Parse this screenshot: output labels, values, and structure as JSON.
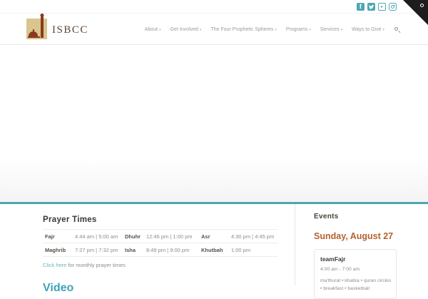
{
  "topbar": {
    "social_links": [
      {
        "name": "facebook",
        "glyph": "f"
      },
      {
        "name": "twitter"
      },
      {
        "name": "youtube",
        "glyph": "▸"
      },
      {
        "name": "instagram"
      }
    ]
  },
  "header": {
    "logo_text": "ISBCC",
    "nav": [
      {
        "label": "About"
      },
      {
        "label": "Get Involved"
      },
      {
        "label": "The Four Prophetic Spheres"
      },
      {
        "label": "Programs"
      },
      {
        "label": "Services"
      },
      {
        "label": "Ways to Give"
      }
    ]
  },
  "prayer_times": {
    "title": "Prayer Times",
    "rows": [
      [
        {
          "label": "Fajr",
          "time": "4:44 am | 5:00 am"
        },
        {
          "label": "Dhuhr",
          "time": "12:46 pm | 1:00 pm"
        },
        {
          "label": "Asr",
          "time": "4:30 pm | 4:45 pm"
        }
      ],
      [
        {
          "label": "Maghrib",
          "time": "7:27 pm | 7:32 pm"
        },
        {
          "label": "Isha",
          "time": "8:49 pm | 9:00 pm"
        },
        {
          "label": "Khutbah",
          "time": "1:00 pm"
        }
      ]
    ],
    "monthly_link": "Click here",
    "monthly_suffix": " for monthly prayer times"
  },
  "video_section": {
    "title": "Video"
  },
  "events": {
    "title": "Events",
    "date_heading": "Sunday, August 27",
    "event": {
      "name": "teamFajr",
      "time": "4:00 am - 7:00 am",
      "description": "ma'thurat • khatira • quran circles • breakfast • basketball"
    }
  },
  "icons": {
    "chevron_down": "▾"
  },
  "colors": {
    "teal": "#4da7ae",
    "link_teal": "#64b7c1",
    "video_teal": "#3da3b9",
    "orange": "#b5622d",
    "logo_tan": "#d9c58d",
    "logo_maroon": "#8a3a20",
    "dark_text": "#3b3733",
    "gray_text": "#8c8c8c",
    "ribbon_black": "#1d1d1d"
  }
}
